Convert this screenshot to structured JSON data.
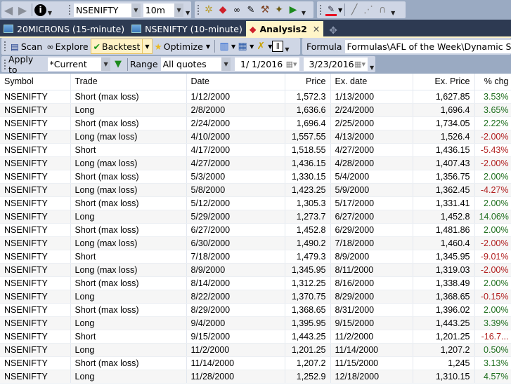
{
  "toolbar1": {
    "back_icon": "back-arrow-icon",
    "forward_icon": "forward-arrow-icon",
    "info_icon": "info-icon",
    "symbol": "NSENIFTY",
    "interval": "10m",
    "icons": [
      "settings-icon",
      "layers-icon",
      "glasses-icon",
      "formula-icon",
      "tools-icon",
      "wand-icon",
      "chart-play-icon"
    ],
    "draw_icons": [
      "pen-color-icon",
      "line-icon",
      "dotted-line-icon",
      "magnet-icon"
    ],
    "accent_color": "#e81123"
  },
  "tabs": [
    {
      "label": "20MICRONS (15-minute)",
      "active": false
    },
    {
      "label": "NSENIFTY (10-minute)",
      "active": false
    },
    {
      "label": "Analysis2",
      "active": true
    }
  ],
  "toolbar2": {
    "scan": "Scan",
    "explore": "Explore",
    "backtest": "Backtest",
    "optimize": "Optimize",
    "formula_label": "Formula",
    "formula_value": "Formulas\\AFL of the Week\\Dynamic Support"
  },
  "toolbar3": {
    "apply_to_label": "Apply to",
    "apply_to_value": "*Current",
    "range_label": "Range",
    "range_value": "All quotes",
    "from_date": "1/  1/2016",
    "to_date": "3/23/2016"
  },
  "table": {
    "columns": [
      "Symbol",
      "Trade",
      "Date",
      "Price",
      "Ex. date",
      "Ex. Price",
      "% chg"
    ],
    "rows": [
      [
        "NSENIFTY",
        "Short (max loss)",
        "1/12/2000",
        "1,572.3",
        "1/13/2000",
        "1,627.85",
        "3.53%"
      ],
      [
        "NSENIFTY",
        "Long",
        "2/8/2000",
        "1,636.6",
        "2/24/2000",
        "1,696.4",
        "3.65%"
      ],
      [
        "NSENIFTY",
        "Short (max loss)",
        "2/24/2000",
        "1,696.4",
        "2/25/2000",
        "1,734.05",
        "2.22%"
      ],
      [
        "NSENIFTY",
        "Long (max loss)",
        "4/10/2000",
        "1,557.55",
        "4/13/2000",
        "1,526.4",
        "-2.00%"
      ],
      [
        "NSENIFTY",
        "Short",
        "4/17/2000",
        "1,518.55",
        "4/27/2000",
        "1,436.15",
        "-5.43%"
      ],
      [
        "NSENIFTY",
        "Long (max loss)",
        "4/27/2000",
        "1,436.15",
        "4/28/2000",
        "1,407.43",
        "-2.00%"
      ],
      [
        "NSENIFTY",
        "Short (max loss)",
        "5/3/2000",
        "1,330.15",
        "5/4/2000",
        "1,356.75",
        "2.00%"
      ],
      [
        "NSENIFTY",
        "Long (max loss)",
        "5/8/2000",
        "1,423.25",
        "5/9/2000",
        "1,362.45",
        "-4.27%"
      ],
      [
        "NSENIFTY",
        "Short (max loss)",
        "5/12/2000",
        "1,305.3",
        "5/17/2000",
        "1,331.41",
        "2.00%"
      ],
      [
        "NSENIFTY",
        "Long",
        "5/29/2000",
        "1,273.7",
        "6/27/2000",
        "1,452.8",
        "14.06%"
      ],
      [
        "NSENIFTY",
        "Short (max loss)",
        "6/27/2000",
        "1,452.8",
        "6/29/2000",
        "1,481.86",
        "2.00%"
      ],
      [
        "NSENIFTY",
        "Long (max loss)",
        "6/30/2000",
        "1,490.2",
        "7/18/2000",
        "1,460.4",
        "-2.00%"
      ],
      [
        "NSENIFTY",
        "Short",
        "7/18/2000",
        "1,479.3",
        "8/9/2000",
        "1,345.95",
        "-9.01%"
      ],
      [
        "NSENIFTY",
        "Long (max loss)",
        "8/9/2000",
        "1,345.95",
        "8/11/2000",
        "1,319.03",
        "-2.00%"
      ],
      [
        "NSENIFTY",
        "Short (max loss)",
        "8/14/2000",
        "1,312.25",
        "8/16/2000",
        "1,338.49",
        "2.00%"
      ],
      [
        "NSENIFTY",
        "Long",
        "8/22/2000",
        "1,370.75",
        "8/29/2000",
        "1,368.65",
        "-0.15%"
      ],
      [
        "NSENIFTY",
        "Short (max loss)",
        "8/29/2000",
        "1,368.65",
        "8/31/2000",
        "1,396.02",
        "2.00%"
      ],
      [
        "NSENIFTY",
        "Long",
        "9/4/2000",
        "1,395.95",
        "9/15/2000",
        "1,443.25",
        "3.39%"
      ],
      [
        "NSENIFTY",
        "Short",
        "9/15/2000",
        "1,443.25",
        "11/2/2000",
        "1,201.25",
        "-16.7..."
      ],
      [
        "NSENIFTY",
        "Long",
        "11/2/2000",
        "1,201.25",
        "11/14/2000",
        "1,207.2",
        "0.50%"
      ],
      [
        "NSENIFTY",
        "Short (max loss)",
        "11/14/2000",
        "1,207.2",
        "11/15/2000",
        "1,245",
        "3.13%"
      ],
      [
        "NSENIFTY",
        "Long",
        "11/28/2000",
        "1,252.9",
        "12/18/2000",
        "1,310.15",
        "4.57%"
      ]
    ]
  },
  "colors": {
    "positive": "#1e6e1e",
    "negative": "#b01e1e",
    "active_tab": "#fff5c9"
  }
}
